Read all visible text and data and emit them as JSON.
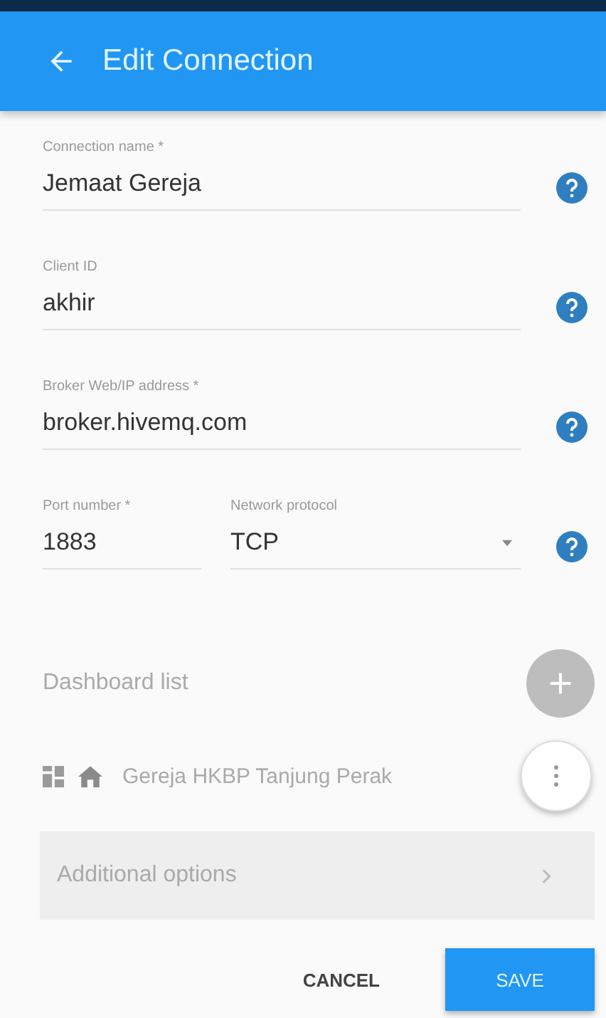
{
  "app_bar": {
    "title": "Edit Connection"
  },
  "form_rows": [
    {
      "fields": [
        {
          "kind": "text",
          "label": "Connection name *",
          "value": "Jemaat Gereja"
        }
      ]
    },
    {
      "fields": [
        {
          "kind": "text",
          "label": "Client ID",
          "value": "akhir"
        }
      ]
    },
    {
      "fields": [
        {
          "kind": "text",
          "label": "Broker Web/IP address *",
          "value": "broker.hivemq.com"
        }
      ]
    },
    {
      "fields": [
        {
          "kind": "text",
          "label": "Port number *",
          "value": "1883"
        },
        {
          "kind": "select",
          "label": "Network protocol",
          "value": "TCP"
        }
      ]
    }
  ],
  "dashboard_list": {
    "title": "Dashboard list",
    "items": [
      {
        "name": "Gereja HKBP Tanjung Perak"
      }
    ]
  },
  "additional_options": {
    "label": "Additional options"
  },
  "buttons": [
    {
      "kind": "flat",
      "label": "CANCEL"
    },
    {
      "kind": "raised",
      "label": "SAVE"
    }
  ]
}
